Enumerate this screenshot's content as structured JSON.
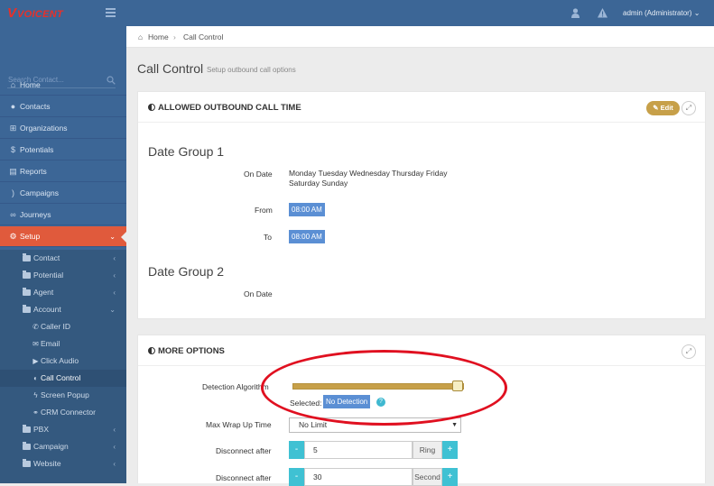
{
  "app": {
    "logo_text": "VOICENT",
    "user": "admin (Administrator)"
  },
  "sidebar": {
    "search_placeholder": "Search Contact...",
    "items": [
      {
        "label": "Home",
        "icon": "home-icon"
      },
      {
        "label": "Contacts",
        "icon": "user-icon"
      },
      {
        "label": "Organizations",
        "icon": "sitemap-icon"
      },
      {
        "label": "Potentials",
        "icon": "dollar-icon"
      },
      {
        "label": "Reports",
        "icon": "file-icon"
      },
      {
        "label": "Campaigns",
        "icon": "rss-icon"
      },
      {
        "label": "Journeys",
        "icon": "binoculars-icon"
      },
      {
        "label": "Setup",
        "icon": "gears-icon"
      }
    ],
    "setup_sub": [
      {
        "label": "Contact"
      },
      {
        "label": "Potential"
      },
      {
        "label": "Agent"
      },
      {
        "label": "Account"
      }
    ],
    "account_sub": [
      {
        "label": "Caller ID",
        "icon": "phone-icon"
      },
      {
        "label": "Email",
        "icon": "envelope-icon"
      },
      {
        "label": "Click Audio",
        "icon": "play-icon"
      },
      {
        "label": "Call Control",
        "icon": "adjust-icon"
      },
      {
        "label": "Screen Popup",
        "icon": "bolt-icon"
      },
      {
        "label": "CRM Connector",
        "icon": "link-icon"
      }
    ],
    "setup_sub2": [
      {
        "label": "PBX"
      },
      {
        "label": "Campaign"
      },
      {
        "label": "Website"
      }
    ]
  },
  "breadcrumb": {
    "home": "Home",
    "current": "Call Control"
  },
  "page": {
    "title": "Call Control",
    "subtitle": "Setup outbound call options"
  },
  "panel1": {
    "title": "ALLOWED OUTBOUND CALL TIME",
    "edit_label": "Edit",
    "group1": {
      "name": "Date Group 1",
      "on_date_label": "On Date",
      "on_date_line1": "Monday Tuesday Wednesday Thursday Friday",
      "on_date_line2": "Saturday Sunday",
      "from_label": "From",
      "from_value": "08:00 AM",
      "to_label": "To",
      "to_value": "08:00 AM"
    },
    "group2": {
      "name": "Date Group 2",
      "on_date_label": "On Date"
    }
  },
  "panel2": {
    "title": "MORE OPTIONS",
    "detection_label": "Detection Algorithm",
    "detection_selected_label": "Selected:",
    "detection_value": "No Detection",
    "detection_level": 1.0,
    "wrap_label": "Max Wrap Up Time",
    "wrap_value": "No Limit",
    "disc1_label": "Disconnect after",
    "disc1_value": "5",
    "disc1_unit": "Ring",
    "disc2_label": "Disconnect after",
    "disc2_value": "30",
    "disc2_unit": "Second"
  },
  "colors": {
    "sidebar": "#3c6696",
    "active": "#e05a3c",
    "accent": "#c7a049",
    "badge": "#5b8fd4",
    "annotation": "#e01020"
  }
}
